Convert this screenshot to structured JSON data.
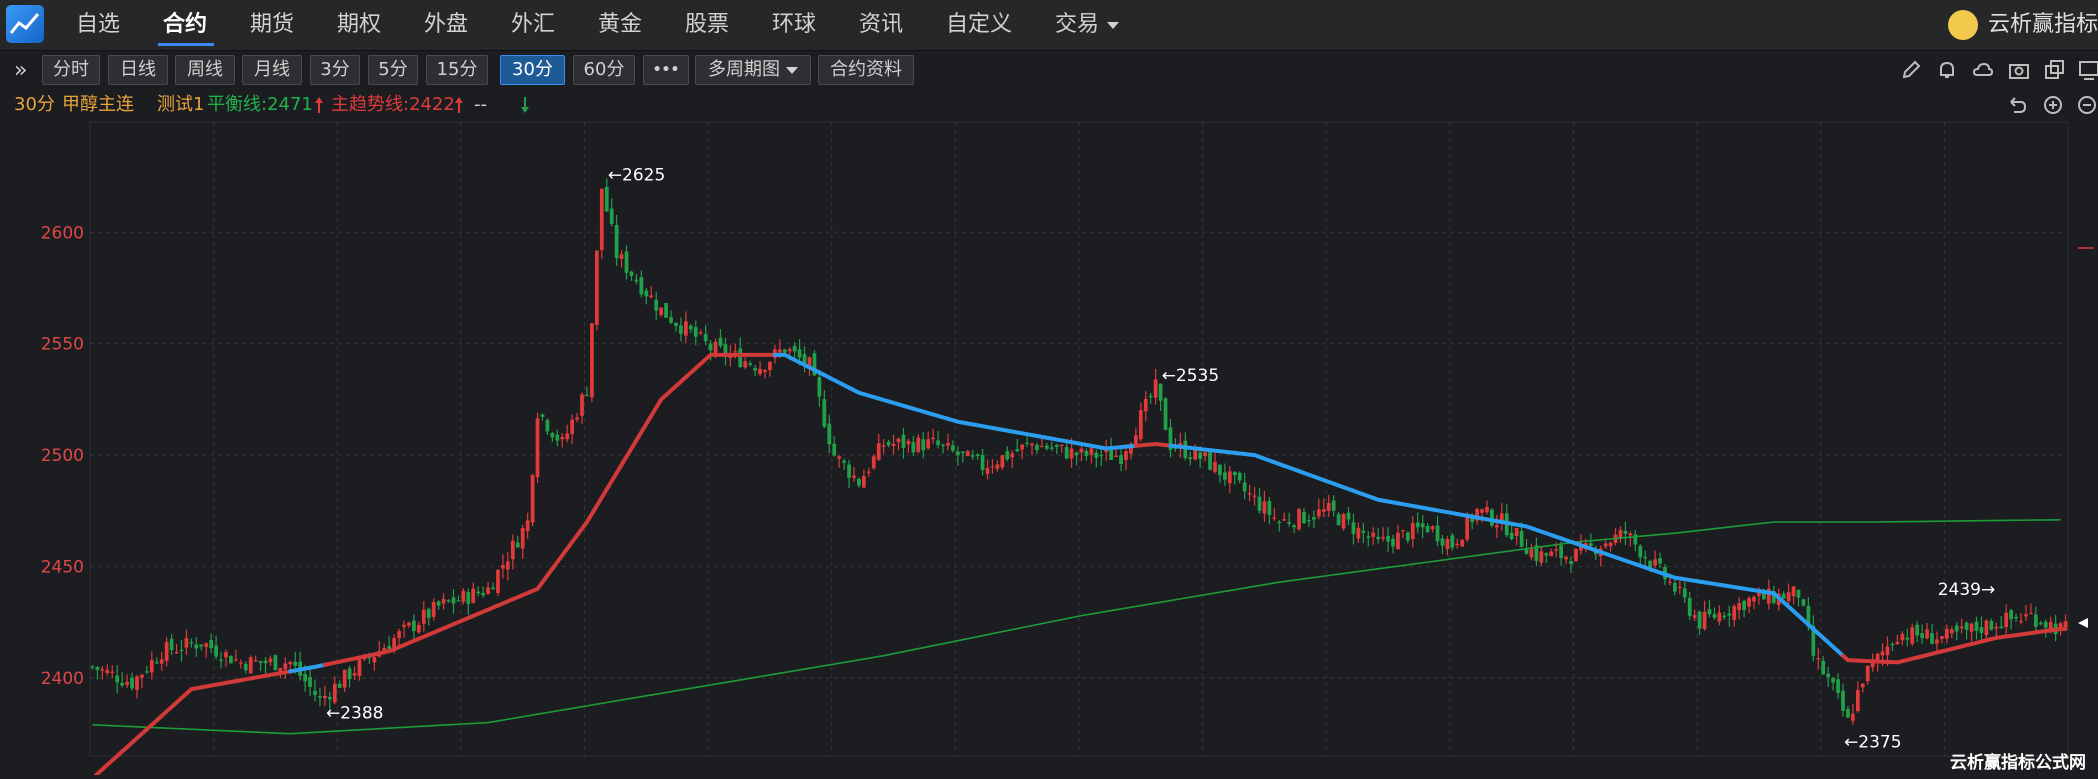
{
  "nav": {
    "items": [
      "自选",
      "合约",
      "期货",
      "期权",
      "外盘",
      "外汇",
      "黄金",
      "股票",
      "环球",
      "资讯",
      "自定义",
      "交易"
    ],
    "active": "合约",
    "brand": "云析赢指标"
  },
  "toolbar": {
    "periods": [
      "分时",
      "日线",
      "周线",
      "月线",
      "3分",
      "5分",
      "15分",
      "30分",
      "60分"
    ],
    "selected": "30分",
    "more": "•••",
    "multi_period": "多周期图",
    "contract_info": "合约资料"
  },
  "info": {
    "period": "30分",
    "name": "甲醇主连",
    "test_label": "测试1",
    "balance_line": "平衡线:2471",
    "trend_line": "主趋势线:2422",
    "dashes": "--"
  },
  "watermark": "云析赢指标公式网",
  "colors": {
    "up": "#e03a3a",
    "down": "#21a04a",
    "trend_up": "#d23a3a",
    "trend_down": "#2b9ef0",
    "balance": "#1e9c3a",
    "axis_text": "#e04848"
  },
  "chart_data": {
    "type": "candlestick",
    "y_ticks": [
      2400,
      2450,
      2500,
      2550,
      2600
    ],
    "ylim": [
      2365,
      2645
    ],
    "annotations": [
      {
        "text": "←2625",
        "bar": 103,
        "value": 2625
      },
      {
        "text": "←2388",
        "bar": 46,
        "value": 2388
      },
      {
        "text": "←2535",
        "bar": 215,
        "value": 2535
      },
      {
        "text": "←2375",
        "bar": 353,
        "value": 2375
      },
      {
        "text": "2439→",
        "bar": 386,
        "value": 2439
      }
    ],
    "waypoints": [
      [
        0,
        2405
      ],
      [
        8,
        2398
      ],
      [
        14,
        2412
      ],
      [
        22,
        2416
      ],
      [
        30,
        2407
      ],
      [
        40,
        2407
      ],
      [
        46,
        2390
      ],
      [
        52,
        2402
      ],
      [
        60,
        2416
      ],
      [
        70,
        2432
      ],
      [
        80,
        2440
      ],
      [
        88,
        2470
      ],
      [
        90,
        2520
      ],
      [
        95,
        2505
      ],
      [
        100,
        2530
      ],
      [
        103,
        2620
      ],
      [
        106,
        2590
      ],
      [
        115,
        2565
      ],
      [
        125,
        2548
      ],
      [
        135,
        2540
      ],
      [
        140,
        2548
      ],
      [
        145,
        2540
      ],
      [
        150,
        2500
      ],
      [
        155,
        2488
      ],
      [
        160,
        2505
      ],
      [
        170,
        2505
      ],
      [
        180,
        2495
      ],
      [
        190,
        2505
      ],
      [
        200,
        2500
      ],
      [
        208,
        2500
      ],
      [
        215,
        2530
      ],
      [
        218,
        2505
      ],
      [
        225,
        2498
      ],
      [
        235,
        2480
      ],
      [
        240,
        2470
      ],
      [
        250,
        2475
      ],
      [
        260,
        2460
      ],
      [
        270,
        2468
      ],
      [
        275,
        2460
      ],
      [
        280,
        2475
      ],
      [
        285,
        2470
      ],
      [
        292,
        2455
      ],
      [
        300,
        2455
      ],
      [
        310,
        2465
      ],
      [
        320,
        2440
      ],
      [
        325,
        2425
      ],
      [
        335,
        2435
      ],
      [
        345,
        2438
      ],
      [
        348,
        2410
      ],
      [
        352,
        2395
      ],
      [
        355,
        2380
      ],
      [
        358,
        2400
      ],
      [
        365,
        2420
      ],
      [
        375,
        2418
      ],
      [
        385,
        2425
      ],
      [
        392,
        2428
      ],
      [
        398,
        2422
      ]
    ],
    "trend_waypoints": [
      [
        0,
        2355
      ],
      [
        20,
        2395
      ],
      [
        45,
        2405
      ],
      [
        60,
        2412
      ],
      [
        90,
        2440
      ],
      [
        100,
        2470
      ],
      [
        115,
        2525
      ],
      [
        125,
        2545
      ],
      [
        140,
        2545
      ],
      [
        155,
        2528
      ],
      [
        175,
        2515
      ],
      [
        205,
        2503
      ],
      [
        215,
        2505
      ],
      [
        235,
        2500
      ],
      [
        260,
        2480
      ],
      [
        290,
        2468
      ],
      [
        320,
        2445
      ],
      [
        340,
        2438
      ],
      [
        355,
        2408
      ],
      [
        365,
        2407
      ],
      [
        385,
        2418
      ],
      [
        398,
        2422
      ]
    ],
    "trend_down_ranges": [
      [
        40,
        46
      ],
      [
        138,
        210
      ],
      [
        218,
        353
      ]
    ],
    "balance_waypoints": [
      [
        0,
        2379
      ],
      [
        40,
        2375
      ],
      [
        80,
        2380
      ],
      [
        120,
        2395
      ],
      [
        160,
        2410
      ],
      [
        200,
        2428
      ],
      [
        240,
        2443
      ],
      [
        280,
        2455
      ],
      [
        300,
        2461
      ],
      [
        320,
        2465
      ],
      [
        340,
        2470
      ],
      [
        360,
        2470
      ],
      [
        398,
        2471
      ]
    ]
  }
}
